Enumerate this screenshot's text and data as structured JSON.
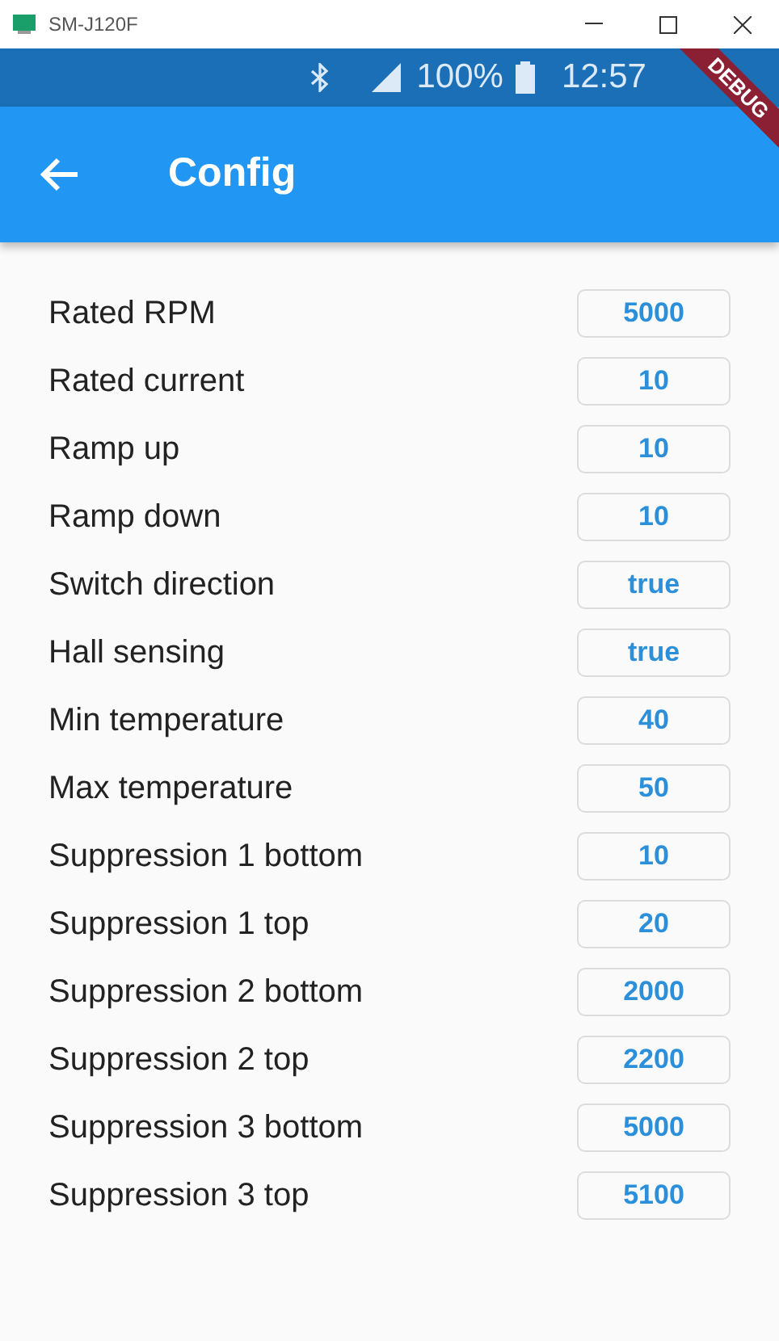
{
  "window": {
    "title": "SM-J120F"
  },
  "status_bar": {
    "battery": "100%",
    "time": "12:57"
  },
  "debug_banner": "DEBUG",
  "app_bar": {
    "title": "Config"
  },
  "settings": [
    {
      "label": "Rated RPM",
      "value": "5000"
    },
    {
      "label": "Rated current",
      "value": "10"
    },
    {
      "label": "Ramp up",
      "value": "10"
    },
    {
      "label": "Ramp down",
      "value": "10"
    },
    {
      "label": "Switch direction",
      "value": "true"
    },
    {
      "label": "Hall sensing",
      "value": "true"
    },
    {
      "label": "Min temperature",
      "value": "40"
    },
    {
      "label": "Max temperature",
      "value": "50"
    },
    {
      "label": "Suppression 1 bottom",
      "value": "10"
    },
    {
      "label": "Suppression 1 top",
      "value": "20"
    },
    {
      "label": "Suppression 2 bottom",
      "value": "2000"
    },
    {
      "label": "Suppression 2 top",
      "value": "2200"
    },
    {
      "label": "Suppression 3 bottom",
      "value": "5000"
    },
    {
      "label": "Suppression 3 top",
      "value": "5100"
    }
  ]
}
